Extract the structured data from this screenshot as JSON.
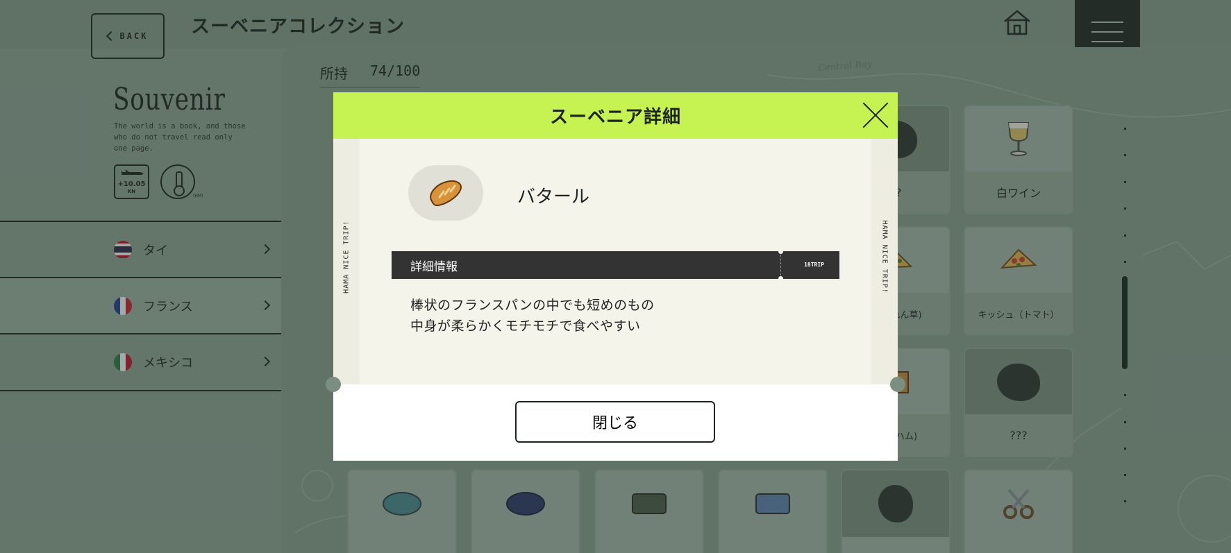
{
  "header": {
    "back_label": "BACK",
    "title": "スーベニアコレクション"
  },
  "sidebar": {
    "brand": "Souvenir",
    "tagline": "The world is a book, and those who do not travel read only one page.",
    "badge_value": "+10.05",
    "badge_unit": "KN",
    "thermo_unit": "(HM)",
    "countries": [
      {
        "label": "タイ",
        "flag": "thailand"
      },
      {
        "label": "フランス",
        "flag": "france",
        "active": true
      },
      {
        "label": "メキシコ",
        "flag": "mexico"
      }
    ]
  },
  "collection": {
    "owned_label": "所持",
    "owned_value": "74/100",
    "map_label": "Central Bay",
    "cards": [
      {
        "label": "??",
        "dark": true
      },
      {
        "label": "白ワイン",
        "icon": "wine-glass-icon"
      },
      {
        "label": "(ほうれん草)",
        "icon": "quiche-icon"
      },
      {
        "label": "キッシュ（トマト）",
        "icon": "quiche-icon"
      },
      {
        "label": "(卵とハム)",
        "icon": "galette-icon"
      },
      {
        "label": "???",
        "dark": true
      }
    ]
  },
  "modal": {
    "title": "スーベニア詳細",
    "item_name": "バタール",
    "info_title": "詳細情報",
    "trip_tag": "18TRIP",
    "stub_text": "HAMA NICE TRIP!",
    "description_line1": "棒状のフランスパンの中でも短めのもの",
    "description_line2": "中身が柔らかくモチモチで食べやすい",
    "close_button": "閉じる"
  },
  "colors": {
    "accent_header": "#c6f351",
    "info_bar": "#333333",
    "ticket_bg": "#f5f4ea"
  }
}
